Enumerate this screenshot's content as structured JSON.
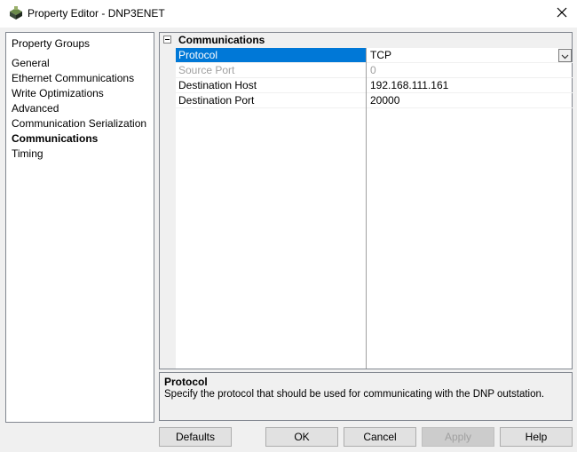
{
  "window": {
    "title": "Property Editor - DNP3ENET",
    "close_icon": "close-icon",
    "app_icon": "property-editor-icon"
  },
  "groups": {
    "header": "Property Groups",
    "items": [
      {
        "label": "General",
        "active": false
      },
      {
        "label": "Ethernet Communications",
        "active": false
      },
      {
        "label": "Write Optimizations",
        "active": false
      },
      {
        "label": "Advanced",
        "active": false
      },
      {
        "label": "Communication Serialization",
        "active": false
      },
      {
        "label": "Communications",
        "active": true
      },
      {
        "label": "Timing",
        "active": false
      }
    ]
  },
  "grid": {
    "category": "Communications",
    "collapse_icon": "collapse-minus-icon",
    "properties": [
      {
        "name": "Protocol",
        "value": "TCP",
        "selected": true,
        "disabled": false,
        "has_dropdown": true
      },
      {
        "name": "Source Port",
        "value": "0",
        "selected": false,
        "disabled": true,
        "has_dropdown": false
      },
      {
        "name": "Destination Host",
        "value": "192.168.111.161",
        "selected": false,
        "disabled": false,
        "has_dropdown": false
      },
      {
        "name": "Destination Port",
        "value": "20000",
        "selected": false,
        "disabled": false,
        "has_dropdown": false
      }
    ]
  },
  "help": {
    "title": "Protocol",
    "description": "Specify the protocol that should be used for communicating with the DNP outstation."
  },
  "buttons": {
    "defaults": "Defaults",
    "ok": "OK",
    "cancel": "Cancel",
    "apply": "Apply",
    "help": "Help"
  },
  "colors": {
    "selection": "#0078d7",
    "disabled_text": "#a0a0a0"
  }
}
